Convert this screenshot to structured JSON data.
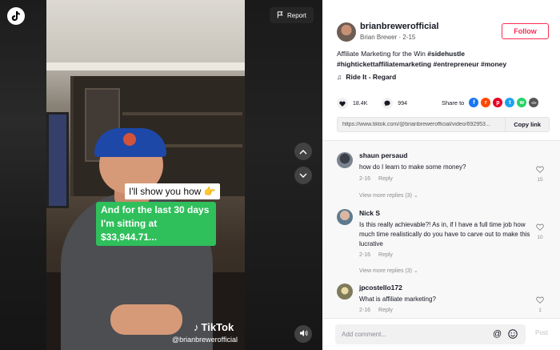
{
  "video": {
    "report_label": "Report",
    "caption_1": "I'll show you how 👉",
    "caption_2_lines": [
      "And for the last 30 days",
      "I'm sitting at",
      "$33,944.71..."
    ],
    "watermark_brand": "TikTok",
    "watermark_handle": "@brianbrewerofficial",
    "icons": {
      "logo": "tiktok-logo-icon",
      "report": "flag-icon",
      "prev": "chevron-up-icon",
      "next": "chevron-down-icon",
      "volume": "speaker-icon"
    }
  },
  "author": {
    "handle": "brianbrewerofficial",
    "subline": "Brian Brewer · 2-15",
    "follow_label": "Follow"
  },
  "description": {
    "text": "Affiliate Marketing for the Win ",
    "tags": [
      "#sidehustle",
      "#hightickettaffiliatemarketing",
      "#entrepreneur",
      "#money"
    ]
  },
  "music": {
    "title": "Ride It - Regard"
  },
  "stats": {
    "likes": "18.4K",
    "comments": "994",
    "share_label": "Share to",
    "share_targets": [
      {
        "name": "facebook-icon",
        "color": "#1877f2",
        "glyph": "f"
      },
      {
        "name": "reddit-icon",
        "color": "#ff4500",
        "glyph": "r"
      },
      {
        "name": "pinterest-icon",
        "color": "#e60023",
        "glyph": "p"
      },
      {
        "name": "twitter-icon",
        "color": "#1da1f2",
        "glyph": "t"
      },
      {
        "name": "whatsapp-icon",
        "color": "#25d366",
        "glyph": "w"
      },
      {
        "name": "embed-icon",
        "color": "#555555",
        "glyph": "</>"
      }
    ]
  },
  "link": {
    "url": "https://www.tiktok.com/@brianbrewerofficial/video/692953...",
    "copy_label": "Copy link"
  },
  "comments": [
    {
      "name": "shaun persaud",
      "text": "how do I learn to make some money?",
      "date": "2-16",
      "reply": "Reply",
      "likes": "15",
      "more": "View more replies (3)"
    },
    {
      "name": "Nick S",
      "text": "Is this really achievable?! As in, if I have a full time job how much time realistically do you have to carve out to make this lucrative",
      "date": "2-16",
      "reply": "Reply",
      "likes": "10",
      "more": "View more replies (3)"
    },
    {
      "name": "jpcostello172",
      "text": "What is affiliate marketing?",
      "date": "2-16",
      "reply": "Reply",
      "likes": "1",
      "more": ""
    }
  ],
  "comment_bar": {
    "placeholder": "Add comment...",
    "post_label": "Post"
  }
}
